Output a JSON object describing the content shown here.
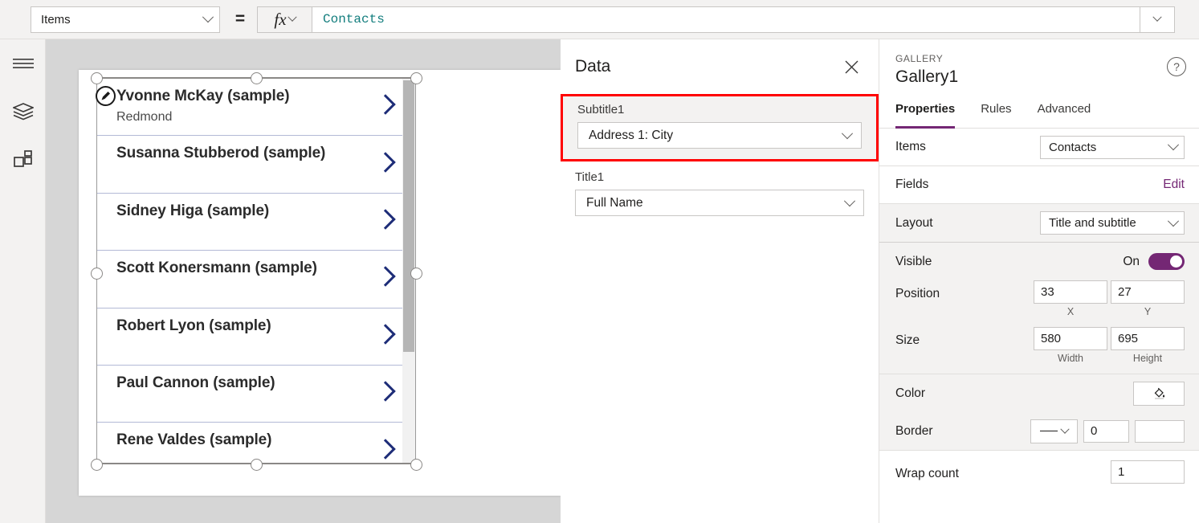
{
  "formula_bar": {
    "property_selected": "Items",
    "equals": "=",
    "fx_label": "fx",
    "formula_value": "Contacts"
  },
  "left_rail": {
    "items": [
      {
        "name": "hamburger-menu-icon",
        "label": "Menu"
      },
      {
        "name": "tree-view-icon",
        "label": "Tree view"
      },
      {
        "name": "insert-icon",
        "label": "Insert"
      }
    ]
  },
  "canvas": {
    "gallery": {
      "rows": [
        {
          "title": "Yvonne McKay (sample)",
          "subtitle": "Redmond"
        },
        {
          "title": "Susanna Stubberod (sample)",
          "subtitle": ""
        },
        {
          "title": "Sidney Higa (sample)",
          "subtitle": ""
        },
        {
          "title": "Scott Konersmann (sample)",
          "subtitle": ""
        },
        {
          "title": "Robert Lyon (sample)",
          "subtitle": ""
        },
        {
          "title": "Paul Cannon (sample)",
          "subtitle": ""
        },
        {
          "title": "Rene Valdes (sample)",
          "subtitle": ""
        }
      ]
    }
  },
  "data_panel": {
    "title": "Data",
    "close_label": "✕",
    "fields": [
      {
        "label": "Subtitle1",
        "value": "Address 1: City",
        "highlighted": true
      },
      {
        "label": "Title1",
        "value": "Full Name",
        "highlighted": false
      }
    ]
  },
  "properties_panel": {
    "kicker": "GALLERY",
    "name": "Gallery1",
    "help_glyph": "?",
    "tabs": [
      {
        "label": "Properties",
        "active": true
      },
      {
        "label": "Rules",
        "active": false
      },
      {
        "label": "Advanced",
        "active": false
      }
    ],
    "rows": {
      "items_label": "Items",
      "items_value": "Contacts",
      "fields_label": "Fields",
      "fields_action": "Edit",
      "layout_label": "Layout",
      "layout_value": "Title and subtitle",
      "visible_label": "Visible",
      "visible_state": "On",
      "position_label": "Position",
      "position_x": "33",
      "position_y": "27",
      "position_x_caption": "X",
      "position_y_caption": "Y",
      "size_label": "Size",
      "size_width": "580",
      "size_height": "695",
      "size_width_caption": "Width",
      "size_height_caption": "Height",
      "color_label": "Color",
      "border_label": "Border",
      "border_thickness": "0",
      "border_color": "#0b1f6b",
      "wrap_count_label": "Wrap count",
      "wrap_count_value": "1"
    }
  },
  "colors": {
    "accent_purple": "#742774",
    "formula_teal": "#127d7d",
    "annotation_red": "#ff0000",
    "chevron_navy": "#1e2d78"
  }
}
